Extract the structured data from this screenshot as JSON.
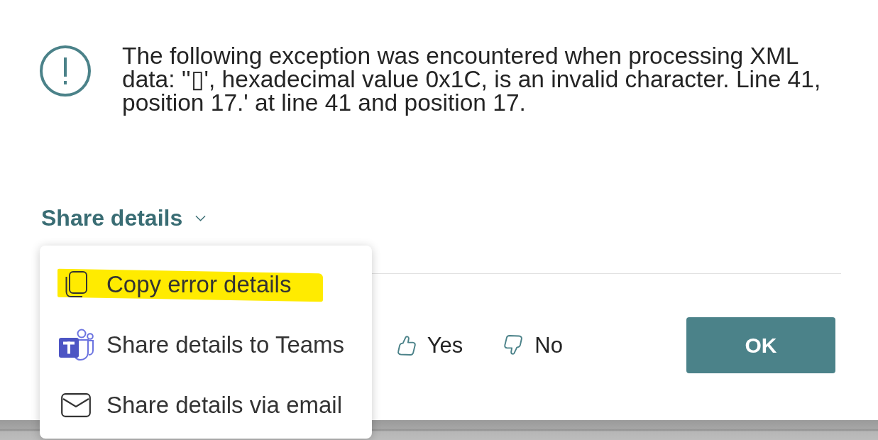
{
  "message": {
    "text": "The following exception was encountered when processing XML data: ''▯', hexadecimal value 0x1C, is an invalid character. Line 41, position 17.' at line 41 and position 17."
  },
  "share_details": {
    "label": "Share details",
    "expanded": true
  },
  "share_menu": {
    "items": [
      {
        "label": "Copy error details",
        "kind": "copy",
        "highlighted": true
      },
      {
        "label": "Share details to Teams",
        "kind": "teams",
        "highlighted": false
      },
      {
        "label": "Share details via email",
        "kind": "email",
        "highlighted": false
      }
    ]
  },
  "feedback": [
    {
      "label": "Yes",
      "kind": "up"
    },
    {
      "label": "No",
      "kind": "down"
    }
  ],
  "ok_button": {
    "label": "OK"
  }
}
